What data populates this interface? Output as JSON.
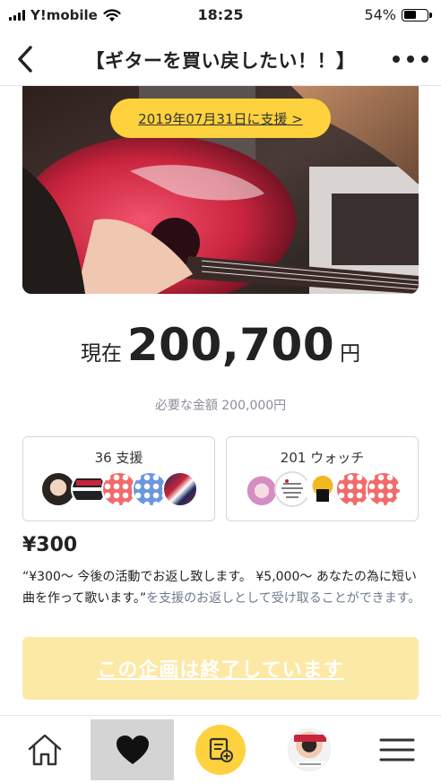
{
  "status_bar": {
    "carrier": "Y!mobile",
    "time": "18:25",
    "battery": "54%",
    "battery_level": 0.54
  },
  "header": {
    "title": "【ギターを買い戻したい！！】",
    "back_icon": "chevron-left-icon",
    "more_icon": "more-dots-icon"
  },
  "hero": {
    "support_date_label": "2019年07月31日に支援 >"
  },
  "funding": {
    "prefix": "現在",
    "amount": "200,700",
    "suffix": "円",
    "required_label": "必要な金額 200,000円"
  },
  "stats": {
    "supporters_label": "36 支援",
    "watch_label": "201 ウォッチ"
  },
  "reward": {
    "price": "¥300",
    "description": "“¥300〜 今後の活動でお返し致します。 ¥5,000〜 あなたの為に短い曲を作って歌います。”",
    "description_tail": "を支援のお返しとして受け取ることができます。",
    "ended_label": "この企画は終了しています"
  },
  "nav": {
    "items": [
      "home-icon",
      "heart-icon",
      "post-add-icon",
      "profile-avatar",
      "menu-icon"
    ]
  },
  "colors": {
    "accent": "#fdd23e",
    "ended_button": "#fde9a6",
    "muted_text": "#8a8f99"
  }
}
